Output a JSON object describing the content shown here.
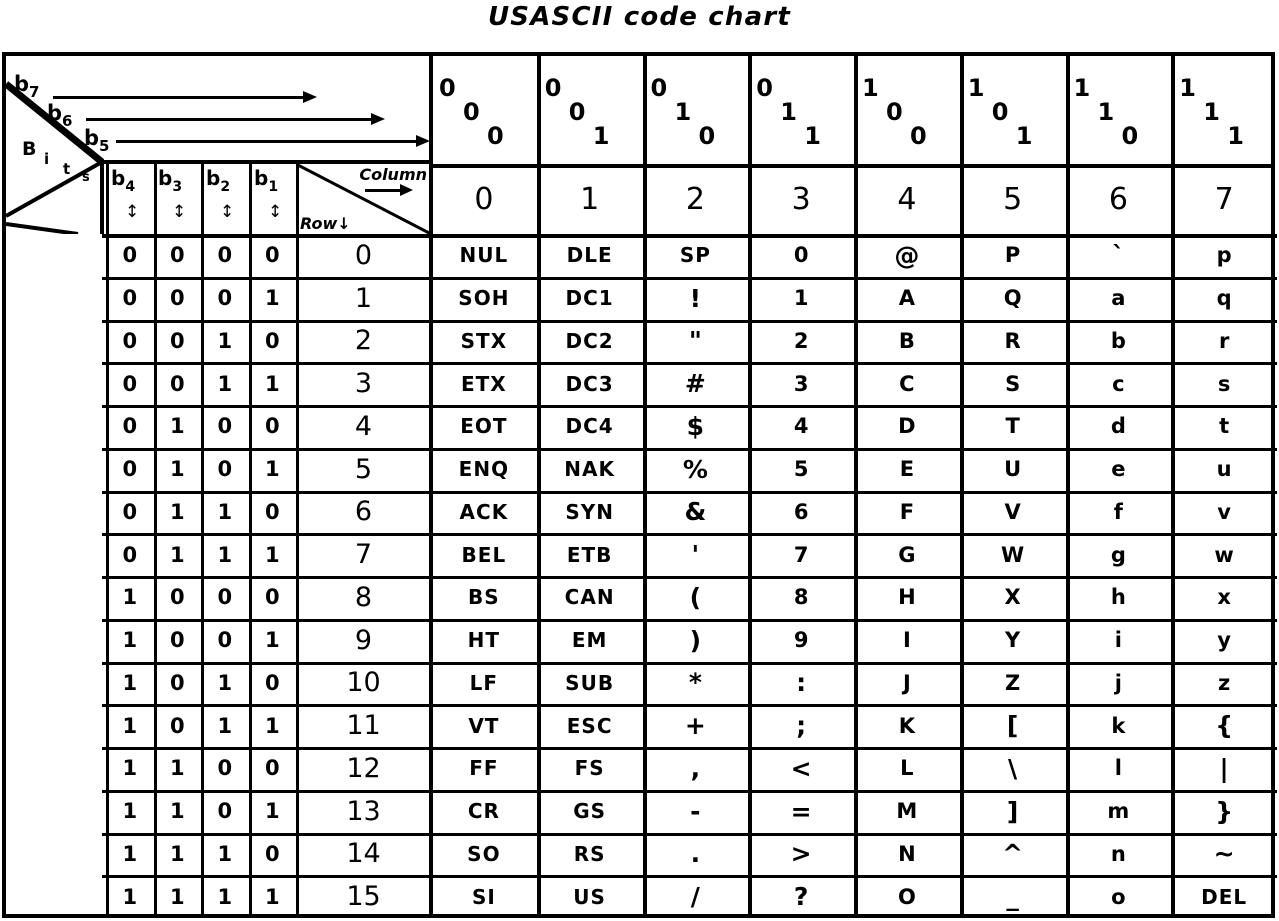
{
  "title": "USASCII code chart",
  "corner": {
    "bits_label": {
      "B": "B",
      "i": "i",
      "t": "t",
      "s": "s"
    },
    "high_bits": [
      {
        "name": "b",
        "sub": "7"
      },
      {
        "name": "b",
        "sub": "6"
      },
      {
        "name": "b",
        "sub": "5"
      }
    ],
    "column_label": "Column",
    "row_label": "Row",
    "column_arrow_icon": "arrow-right-icon",
    "row_arrow_icon": "arrow-down-icon",
    "row_arrow_glyph": "↓"
  },
  "low_bits": [
    {
      "name": "b",
      "sub": "4",
      "arrow": "↕"
    },
    {
      "name": "b",
      "sub": "3",
      "arrow": "↕"
    },
    {
      "name": "b",
      "sub": "2",
      "arrow": "↕"
    },
    {
      "name": "b",
      "sub": "1",
      "arrow": "↕"
    }
  ],
  "column_bit_patterns": [
    [
      "0",
      "0",
      "0"
    ],
    [
      "0",
      "0",
      "1"
    ],
    [
      "0",
      "1",
      "0"
    ],
    [
      "0",
      "1",
      "1"
    ],
    [
      "1",
      "0",
      "0"
    ],
    [
      "1",
      "0",
      "1"
    ],
    [
      "1",
      "1",
      "0"
    ],
    [
      "1",
      "1",
      "1"
    ]
  ],
  "column_numbers": [
    "0",
    "1",
    "2",
    "3",
    "4",
    "5",
    "6",
    "7"
  ],
  "rows": [
    {
      "bits": [
        "0",
        "0",
        "0",
        "0"
      ],
      "num": "0",
      "cells": [
        "NUL",
        "DLE",
        "SP",
        "0",
        "@",
        "P",
        "`",
        "p"
      ]
    },
    {
      "bits": [
        "0",
        "0",
        "0",
        "1"
      ],
      "num": "1",
      "cells": [
        "SOH",
        "DC1",
        "!",
        "1",
        "A",
        "Q",
        "a",
        "q"
      ]
    },
    {
      "bits": [
        "0",
        "0",
        "1",
        "0"
      ],
      "num": "2",
      "cells": [
        "STX",
        "DC2",
        "\"",
        "2",
        "B",
        "R",
        "b",
        "r"
      ]
    },
    {
      "bits": [
        "0",
        "0",
        "1",
        "1"
      ],
      "num": "3",
      "cells": [
        "ETX",
        "DC3",
        "#",
        "3",
        "C",
        "S",
        "c",
        "s"
      ]
    },
    {
      "bits": [
        "0",
        "1",
        "0",
        "0"
      ],
      "num": "4",
      "cells": [
        "EOT",
        "DC4",
        "$",
        "4",
        "D",
        "T",
        "d",
        "t"
      ]
    },
    {
      "bits": [
        "0",
        "1",
        "0",
        "1"
      ],
      "num": "5",
      "cells": [
        "ENQ",
        "NAK",
        "%",
        "5",
        "E",
        "U",
        "e",
        "u"
      ]
    },
    {
      "bits": [
        "0",
        "1",
        "1",
        "0"
      ],
      "num": "6",
      "cells": [
        "ACK",
        "SYN",
        "&",
        "6",
        "F",
        "V",
        "f",
        "v"
      ]
    },
    {
      "bits": [
        "0",
        "1",
        "1",
        "1"
      ],
      "num": "7",
      "cells": [
        "BEL",
        "ETB",
        "'",
        "7",
        "G",
        "W",
        "g",
        "w"
      ]
    },
    {
      "bits": [
        "1",
        "0",
        "0",
        "0"
      ],
      "num": "8",
      "cells": [
        "BS",
        "CAN",
        "(",
        "8",
        "H",
        "X",
        "h",
        "x"
      ]
    },
    {
      "bits": [
        "1",
        "0",
        "0",
        "1"
      ],
      "num": "9",
      "cells": [
        "HT",
        "EM",
        ")",
        "9",
        "I",
        "Y",
        "i",
        "y"
      ]
    },
    {
      "bits": [
        "1",
        "0",
        "1",
        "0"
      ],
      "num": "10",
      "cells": [
        "LF",
        "SUB",
        "*",
        ":",
        "J",
        "Z",
        "j",
        "z"
      ]
    },
    {
      "bits": [
        "1",
        "0",
        "1",
        "1"
      ],
      "num": "11",
      "cells": [
        "VT",
        "ESC",
        "+",
        ";",
        "K",
        "[",
        "k",
        "{"
      ]
    },
    {
      "bits": [
        "1",
        "1",
        "0",
        "0"
      ],
      "num": "12",
      "cells": [
        "FF",
        "FS",
        ",",
        "<",
        "L",
        "\\",
        "l",
        "|"
      ]
    },
    {
      "bits": [
        "1",
        "1",
        "0",
        "1"
      ],
      "num": "13",
      "cells": [
        "CR",
        "GS",
        "-",
        "=",
        "M",
        "]",
        "m",
        "}"
      ]
    },
    {
      "bits": [
        "1",
        "1",
        "1",
        "0"
      ],
      "num": "14",
      "cells": [
        "SO",
        "RS",
        ".",
        ">",
        "N",
        "^",
        "n",
        "~"
      ]
    },
    {
      "bits": [
        "1",
        "1",
        "1",
        "1"
      ],
      "num": "15",
      "cells": [
        "SI",
        "US",
        "/",
        "?",
        "O",
        "_",
        "o",
        "DEL"
      ]
    }
  ],
  "colors": {
    "ink": "#000000",
    "paper": "#ffffff"
  }
}
